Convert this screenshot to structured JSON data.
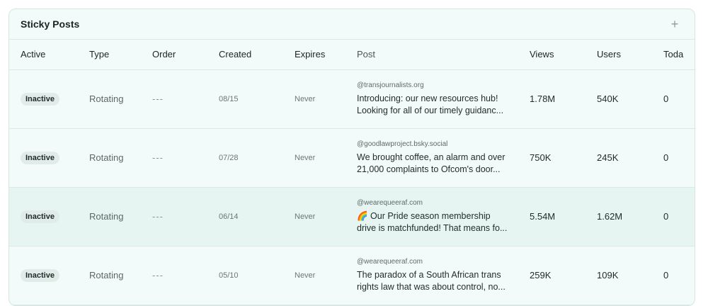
{
  "panel": {
    "title": "Sticky Posts",
    "add_symbol": "+"
  },
  "columns": {
    "active": "Active",
    "type": "Type",
    "order": "Order",
    "created": "Created",
    "expires": "Expires",
    "post": "Post",
    "views": "Views",
    "users": "Users",
    "today": "Toda"
  },
  "rows": [
    {
      "active": "Inactive",
      "type": "Rotating",
      "order": "---",
      "created": "08/15",
      "expires": "Never",
      "handle": "@transjournalists.org",
      "text_line1": "Introducing: our new resources hub!",
      "text_line2": "Looking for all of our timely guidanc...",
      "views": "1.78M",
      "users": "540K",
      "today": "0"
    },
    {
      "active": "Inactive",
      "type": "Rotating",
      "order": "---",
      "created": "07/28",
      "expires": "Never",
      "handle": "@goodlawproject.bsky.social",
      "text_line1": "We brought coffee, an alarm and over",
      "text_line2": "21,000 complaints to Ofcom's door...",
      "views": "750K",
      "users": "245K",
      "today": "0"
    },
    {
      "active": "Inactive",
      "type": "Rotating",
      "order": "---",
      "created": "06/14",
      "expires": "Never",
      "handle": "@wearequeeraf.com",
      "text_line1": "🌈 Our Pride season membership",
      "text_line2": "drive is matchfunded! That means fo...",
      "views": "5.54M",
      "users": "1.62M",
      "today": "0"
    },
    {
      "active": "Inactive",
      "type": "Rotating",
      "order": "---",
      "created": "05/10",
      "expires": "Never",
      "handle": "@wearequeeraf.com",
      "text_line1": "The paradox of a South African trans",
      "text_line2": "rights law that was about control, no...",
      "views": "259K",
      "users": "109K",
      "today": "0"
    }
  ]
}
